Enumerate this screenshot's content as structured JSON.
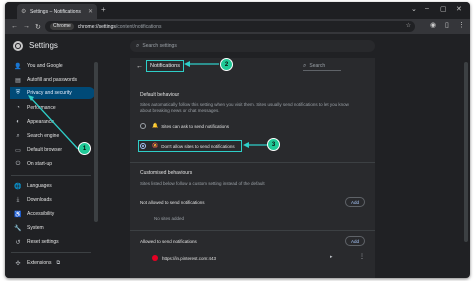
{
  "browser": {
    "tab_title": "Settings – Notifications",
    "chip_label": "Chrome",
    "url_host": "chrome://settings",
    "url_path": "/content/notifications"
  },
  "header": {
    "title": "Settings",
    "search_placeholder": "Search settings"
  },
  "sidebar": {
    "items": [
      {
        "label": "You and Google",
        "icon": "person-icon"
      },
      {
        "label": "Autofill and passwords",
        "icon": "autofill-icon"
      },
      {
        "label": "Privacy and security",
        "icon": "shield-icon",
        "active": true
      },
      {
        "label": "Performance",
        "icon": "gauge-icon"
      },
      {
        "label": "Appearance",
        "icon": "palette-icon"
      },
      {
        "label": "Search engine",
        "icon": "search-icon"
      },
      {
        "label": "Default browser",
        "icon": "browser-icon"
      },
      {
        "label": "On start-up",
        "icon": "power-icon"
      },
      {
        "label": "Languages",
        "icon": "globe-icon"
      },
      {
        "label": "Downloads",
        "icon": "download-icon"
      },
      {
        "label": "Accessibility",
        "icon": "accessibility-icon"
      },
      {
        "label": "System",
        "icon": "wrench-icon"
      },
      {
        "label": "Reset settings",
        "icon": "reset-icon"
      },
      {
        "label": "Extensions",
        "icon": "puzzle-icon"
      }
    ]
  },
  "main": {
    "page_title": "Notifications",
    "search_label": "Search",
    "default_behaviour": {
      "heading": "Default behaviour",
      "description": "Sites automatically follow this setting when you visit them. Sites usually send notifications to let you know about breaking news or chat messages.",
      "option_allow": "Sites can ask to send notifications",
      "option_block": "Don't allow sites to send notifications"
    },
    "customised": {
      "heading": "Customised behaviours",
      "description": "Sites listed below follow a custom setting instead of the default",
      "not_allowed_label": "Not allowed to send notifications",
      "no_sites": "No sites added",
      "allowed_label": "Allowed to send notifications",
      "add_label": "Add",
      "site": "https://in.pinterest.com:443"
    }
  },
  "callouts": [
    "1",
    "2",
    "3"
  ],
  "colors": {
    "accent": "#2ecec8",
    "callout": "#20c997",
    "active_nav": "#004a77"
  }
}
